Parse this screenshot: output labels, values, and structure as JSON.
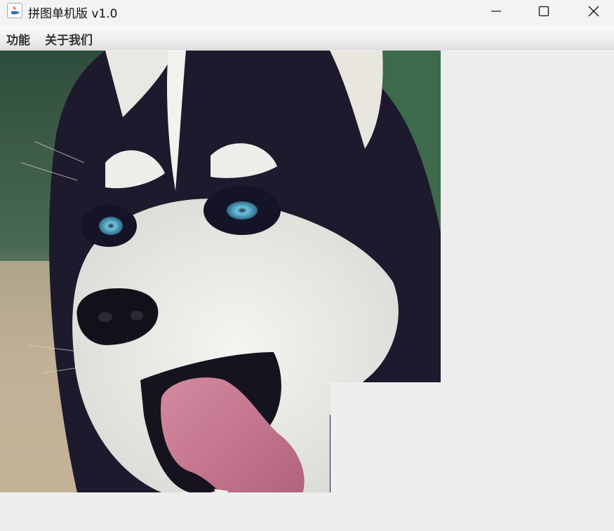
{
  "window": {
    "title": "拼图单机版 v1.0",
    "app_icon": "java-cup-icon",
    "controls": [
      "minimize-icon",
      "maximize-icon",
      "close-icon"
    ]
  },
  "menubar": {
    "items": [
      {
        "label": "功能"
      },
      {
        "label": "关于我们"
      }
    ]
  },
  "board": {
    "image": "husky-dog-photo",
    "grid": [
      4,
      4
    ],
    "blank_tile": {
      "row": 3,
      "col": 3
    }
  },
  "colors": {
    "background": "#eeeeee",
    "dog_dark": "#1c1a2c",
    "dog_white": "#eef0ea",
    "tongue": "#c97892",
    "eye": "#5fb4d2",
    "foliage": "#3c5a44"
  }
}
